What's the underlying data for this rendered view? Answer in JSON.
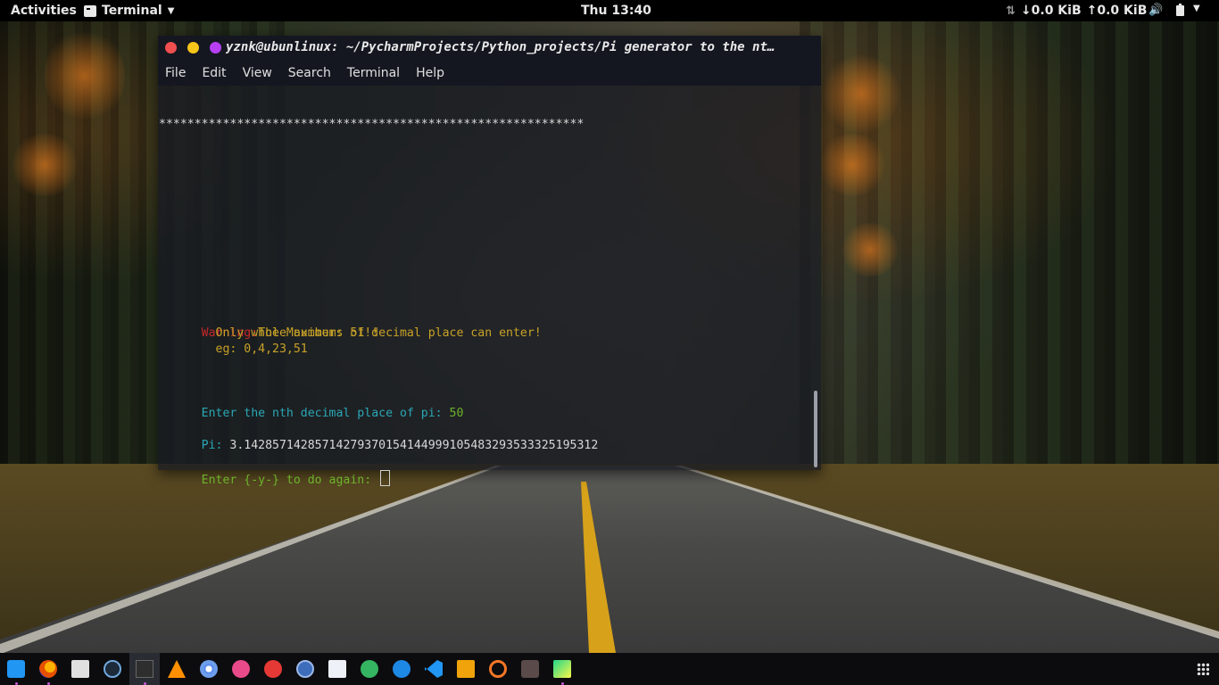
{
  "topbar": {
    "activities": "Activities",
    "app_menu_label": "Terminal",
    "clock": "Thu 13:40",
    "net_down": "↓0.0 KiB",
    "net_up": "↑0.0 KiB"
  },
  "window": {
    "title": "yznk@ubunlinux: ~/PycharmProjects/Python_projects/Pi generator to the nt…",
    "menu": [
      "File",
      "Edit",
      "View",
      "Search",
      "Terminal",
      "Help"
    ]
  },
  "terminal": {
    "stars": "************************************************************",
    "warning_label": "Warning:",
    "warning_text": "The Maximum: 51!!",
    "warning_line2": "        Only whole numbers of decimal place can enter!",
    "warning_line3": "        eg: 0,4,23,51",
    "prompt_text": "Enter the nth decimal place of pi: ",
    "prompt_value": "50",
    "pi_label": "Pi: ",
    "pi_value": "3.14285714285714279370154144999105483293533325195312",
    "again_prompt": "Enter {-y-} to do again: "
  },
  "dock": {
    "apps": [
      "files-icon",
      "firefox-icon",
      "image-viewer-icon",
      "settings-wheel-icon",
      "terminal-icon",
      "vlc-icon",
      "chromium-icon",
      "audio-recorder-icon",
      "music-icon",
      "system-settings-icon",
      "text-editor-icon",
      "spotify-icon",
      "browser-icon",
      "vscode-icon",
      "sublime-text-icon",
      "jupyter-icon",
      "screen-recorder-icon",
      "pycharm-icon"
    ],
    "app_grid": "show-applications-icon"
  },
  "colors": {
    "warning_red": "#c62828",
    "warning_yellow": "#c9a227",
    "prompt_cyan": "#2aa7b5",
    "input_green": "#6db32b",
    "close_btn": "#f04f4f",
    "min_btn": "#f5c518",
    "max_btn": "#b73ff2"
  }
}
